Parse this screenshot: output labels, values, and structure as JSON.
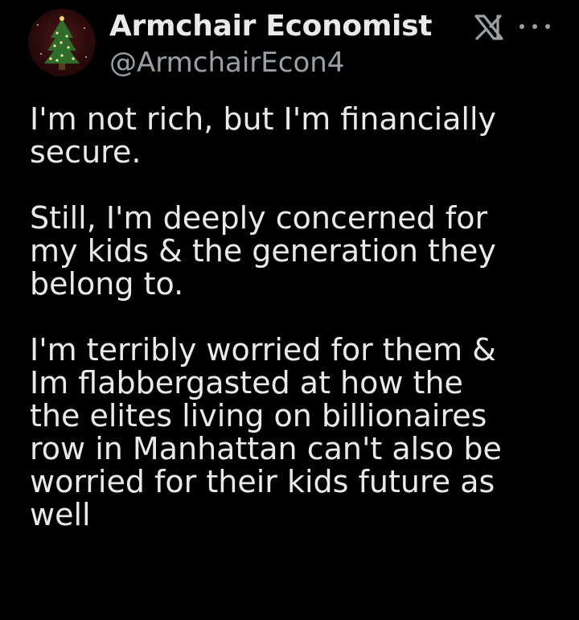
{
  "author": {
    "display_name": "Armchair Economist",
    "handle": "@ArmchairEcon4",
    "avatar_icon": "christmas-tree-avatar"
  },
  "header_icons": {
    "platform_logo": "x-logo-icon",
    "more_options": "more-options-icon"
  },
  "tweet": {
    "paragraphs": [
      "I'm not rich, but I'm financially\nsecure.",
      "Still, I'm deeply concerned for\nmy kids  & the generation they\nbelong to.",
      "I'm terribly worried for them &\nIm flabbergasted at how the\nthe elites living on billionaires\nrow in Manhattan can't also be\nworried for their kids future as\nwell"
    ]
  },
  "colors": {
    "background": "#000000",
    "primary_text": "#e7e9ea",
    "secondary_text": "#9aa0a6"
  }
}
